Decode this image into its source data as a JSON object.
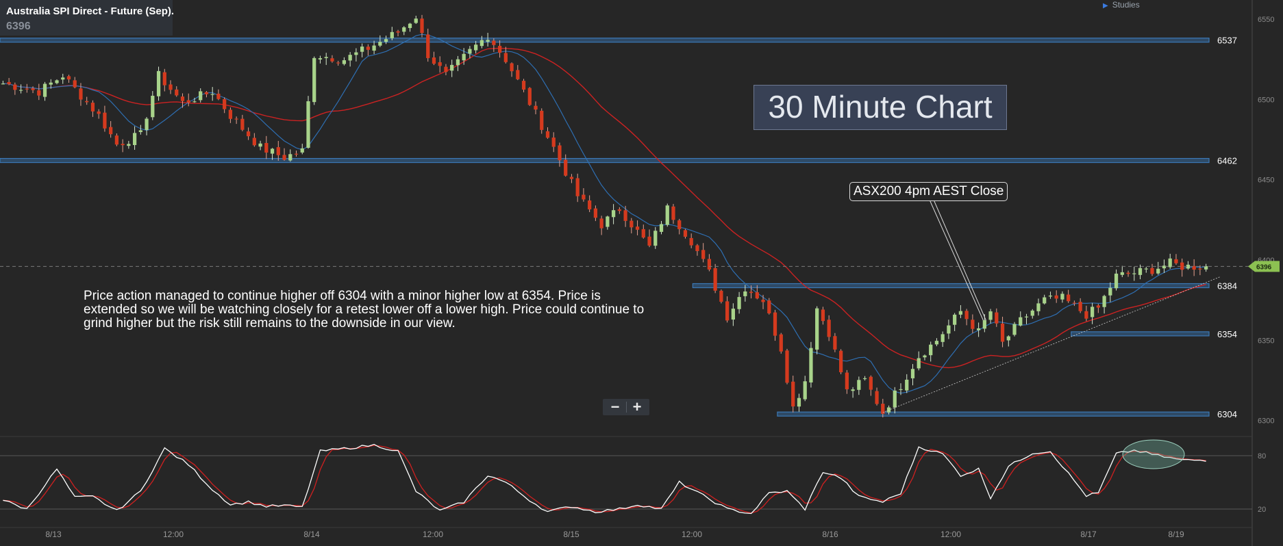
{
  "header": {
    "title": "Australia SPI Direct - Future (Sep).",
    "price": "6396",
    "studies_label": "Studies",
    "chart_label": "30 Minute Chart"
  },
  "annotations": {
    "callout": "ASX200 4pm AEST Close",
    "commentary": "Price action managed to continue higher off 6304 with a minor higher low at 6354. Price is extended so we will be watching closely for a retest lower off a lower high. Price could continue to grind higher but the risk still remains to the downside in our view."
  },
  "controls": {
    "zoom_out": "−",
    "zoom_in": "+"
  },
  "colors": {
    "background": "#262626",
    "up_candle": "#a8d38a",
    "down_candle": "#d53a1e",
    "ma_fast": "#2e6fb3",
    "ma_slow": "#cc2222",
    "level_line": "#3b78b5",
    "stoch_k": "#ffffff",
    "stoch_d": "#d02020",
    "price_tag": "#8cc152"
  },
  "chart_data": [
    {
      "type": "candlestick",
      "title": "Australia SPI Direct - Future (Sep).",
      "last_price": 6396,
      "ylim": [
        6290,
        6562
      ],
      "y_ticks": [
        6300,
        6350,
        6400,
        6450,
        6500,
        6550
      ],
      "x_tick_labels": [
        "8/13",
        "12:00",
        "8/14",
        "12:00",
        "8/15",
        "12:00",
        "8/16",
        "12:00",
        "8/17",
        "8/19"
      ],
      "levels": [
        {
          "label": "6537",
          "value": 6537,
          "from": 0,
          "to": 1
        },
        {
          "label": "6462",
          "value": 6462,
          "from": 0,
          "to": 1
        },
        {
          "label": "6384",
          "value": 6384,
          "from": 0.573,
          "to": 1
        },
        {
          "label": "6354",
          "value": 6354,
          "from": 0.886,
          "to": 1
        },
        {
          "label": "6304",
          "value": 6304,
          "from": 0.643,
          "to": 1
        }
      ],
      "trendline": {
        "from_index": 147,
        "from_value": 6305,
        "to_index": 201,
        "to_value": 6386
      },
      "callout_index": 164,
      "series": [
        {
          "name": "MA fast",
          "kind": "moving_average",
          "period": 10
        },
        {
          "name": "MA slow",
          "kind": "moving_average",
          "period": 30
        }
      ],
      "keypoints": [
        [
          0,
          6510
        ],
        [
          6,
          6505
        ],
        [
          10,
          6515
        ],
        [
          16,
          6490
        ],
        [
          19,
          6472
        ],
        [
          23,
          6478
        ],
        [
          26,
          6515
        ],
        [
          30,
          6498
        ],
        [
          35,
          6505
        ],
        [
          38,
          6490
        ],
        [
          43,
          6470
        ],
        [
          47,
          6464
        ],
        [
          50,
          6468
        ],
        [
          52,
          6528
        ],
        [
          57,
          6525
        ],
        [
          61,
          6532
        ],
        [
          66,
          6542
        ],
        [
          69,
          6552
        ],
        [
          71,
          6528
        ],
        [
          74,
          6515
        ],
        [
          78,
          6530
        ],
        [
          81,
          6540
        ],
        [
          84,
          6525
        ],
        [
          88,
          6498
        ],
        [
          92,
          6470
        ],
        [
          96,
          6440
        ],
        [
          100,
          6422
        ],
        [
          103,
          6432
        ],
        [
          108,
          6408
        ],
        [
          111,
          6432
        ],
        [
          115,
          6412
        ],
        [
          118,
          6392
        ],
        [
          121,
          6365
        ],
        [
          124,
          6383
        ],
        [
          127,
          6375
        ],
        [
          130,
          6345
        ],
        [
          132,
          6308
        ],
        [
          134,
          6325
        ],
        [
          136,
          6370
        ],
        [
          138,
          6355
        ],
        [
          141,
          6318
        ],
        [
          144,
          6325
        ],
        [
          147,
          6305
        ],
        [
          150,
          6322
        ],
        [
          153,
          6340
        ],
        [
          156,
          6350
        ],
        [
          160,
          6368
        ],
        [
          163,
          6355
        ],
        [
          165,
          6368
        ],
        [
          167,
          6348
        ],
        [
          170,
          6362
        ],
        [
          174,
          6375
        ],
        [
          177,
          6376
        ],
        [
          181,
          6366
        ],
        [
          183,
          6370
        ],
        [
          186,
          6390
        ],
        [
          189,
          6392
        ],
        [
          192,
          6394
        ],
        [
          195,
          6398
        ],
        [
          197,
          6396
        ]
      ]
    },
    {
      "type": "line",
      "title": "",
      "ylim": [
        0,
        100
      ],
      "y_ticks": [
        20,
        80
      ],
      "series": [
        {
          "name": "",
          "kind": "stochastic_k"
        },
        {
          "name": "",
          "kind": "stochastic_d"
        }
      ],
      "keypoints": [
        [
          0,
          30
        ],
        [
          4,
          20
        ],
        [
          9,
          65
        ],
        [
          12,
          33
        ],
        [
          15,
          34
        ],
        [
          19,
          18
        ],
        [
          23,
          40
        ],
        [
          27,
          88
        ],
        [
          31,
          70
        ],
        [
          35,
          42
        ],
        [
          38,
          25
        ],
        [
          41,
          28
        ],
        [
          44,
          23
        ],
        [
          47,
          24
        ],
        [
          50,
          22
        ],
        [
          53,
          85
        ],
        [
          57,
          88
        ],
        [
          62,
          92
        ],
        [
          66,
          85
        ],
        [
          69,
          40
        ],
        [
          73,
          18
        ],
        [
          77,
          28
        ],
        [
          81,
          58
        ],
        [
          84,
          50
        ],
        [
          88,
          30
        ],
        [
          91,
          17
        ],
        [
          95,
          23
        ],
        [
          99,
          17
        ],
        [
          103,
          20
        ],
        [
          106,
          25
        ],
        [
          110,
          20
        ],
        [
          113,
          50
        ],
        [
          117,
          35
        ],
        [
          121,
          20
        ],
        [
          125,
          15
        ],
        [
          128,
          38
        ],
        [
          131,
          40
        ],
        [
          134,
          20
        ],
        [
          137,
          62
        ],
        [
          140,
          55
        ],
        [
          143,
          34
        ],
        [
          147,
          28
        ],
        [
          150,
          38
        ],
        [
          153,
          90
        ],
        [
          157,
          82
        ],
        [
          160,
          58
        ],
        [
          163,
          65
        ],
        [
          165,
          33
        ],
        [
          168,
          68
        ],
        [
          172,
          83
        ],
        [
          175,
          85
        ],
        [
          178,
          60
        ],
        [
          181,
          35
        ],
        [
          183,
          38
        ],
        [
          186,
          82
        ],
        [
          189,
          86
        ],
        [
          193,
          80
        ],
        [
          197,
          75
        ]
      ]
    }
  ]
}
